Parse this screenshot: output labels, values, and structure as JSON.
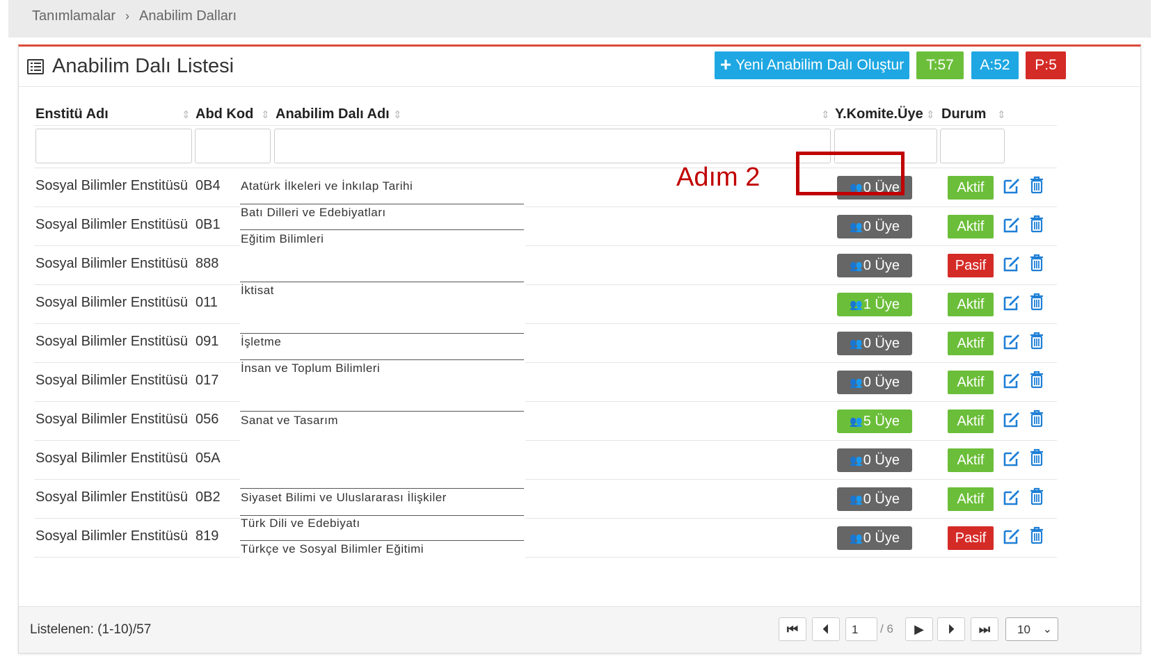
{
  "breadcrumb": {
    "items": [
      "Tanımlamalar",
      "Anabilim Dalları"
    ],
    "separator": "›"
  },
  "panel": {
    "title": "Anabilim Dalı Listesi",
    "new_button": "Yeni Anabilim Dalı Oluştur",
    "counts": {
      "total": "T:57",
      "active": "A:52",
      "passive": "P:5"
    }
  },
  "table": {
    "columns": [
      "Enstitü Adı",
      "Abd Kod",
      "Anabilim Dalı Adı",
      "Y.Komite.Üye",
      "Durum"
    ],
    "rows": [
      {
        "enstitu": "Sosyal Bilimler Enstitüsü",
        "kod": "0B4",
        "uye": "0 Üye",
        "uye_active": false,
        "durum": "Aktif"
      },
      {
        "enstitu": "Sosyal Bilimler Enstitüsü",
        "kod": "0B1",
        "uye": "0 Üye",
        "uye_active": false,
        "durum": "Aktif"
      },
      {
        "enstitu": "Sosyal Bilimler Enstitüsü",
        "kod": "888",
        "uye": "0 Üye",
        "uye_active": false,
        "durum": "Pasif"
      },
      {
        "enstitu": "Sosyal Bilimler Enstitüsü",
        "kod": "011",
        "uye": "1 Üye",
        "uye_active": true,
        "durum": "Aktif"
      },
      {
        "enstitu": "Sosyal Bilimler Enstitüsü",
        "kod": "091",
        "uye": "0 Üye",
        "uye_active": false,
        "durum": "Aktif"
      },
      {
        "enstitu": "Sosyal Bilimler Enstitüsü",
        "kod": "017",
        "uye": "0 Üye",
        "uye_active": false,
        "durum": "Aktif"
      },
      {
        "enstitu": "Sosyal Bilimler Enstitüsü",
        "kod": "056",
        "uye": "5 Üye",
        "uye_active": true,
        "durum": "Aktif"
      },
      {
        "enstitu": "Sosyal Bilimler Enstitüsü",
        "kod": "05A",
        "uye": "0 Üye",
        "uye_active": false,
        "durum": "Aktif"
      },
      {
        "enstitu": "Sosyal Bilimler Enstitüsü",
        "kod": "0B2",
        "uye": "0 Üye",
        "uye_active": false,
        "durum": "Aktif"
      },
      {
        "enstitu": "Sosyal Bilimler Enstitüsü",
        "kod": "819",
        "uye": "0 Üye",
        "uye_active": false,
        "durum": "Pasif"
      }
    ]
  },
  "anabilim_dali_overlay": [
    "Atatürk İlkeleri ve İnkılap Tarihi",
    "Batı Dilleri ve Edebiyatları",
    "Eğitim Bilimleri",
    "İktisat",
    "İşletme",
    "İnsan ve Toplum Bilimleri",
    "Sanat ve Tasarım",
    "Siyaset Bilimi ve Uluslararası İlişkiler",
    "Türk Dili ve Edebiyatı",
    "Türkçe ve Sosyal Bilimler Eğitimi"
  ],
  "annotation": {
    "label": "Adım 2",
    "color": "#c00000"
  },
  "footer": {
    "info": "Listelenen: (1-10)/57",
    "page": "1",
    "of": "/ 6",
    "page_size": "10"
  },
  "colors": {
    "accent_blue": "#1ea7e2",
    "green": "#6bbe39",
    "red": "#d52b27",
    "gray_badge": "#666666",
    "panel_top_border": "#dd4b39"
  }
}
